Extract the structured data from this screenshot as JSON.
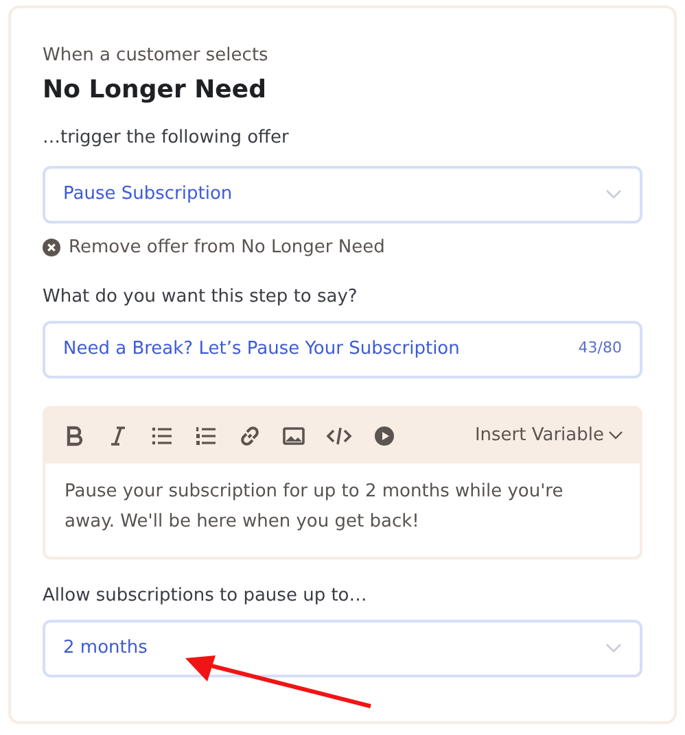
{
  "trigger": {
    "caption": "When a customer selects",
    "reason": "No Longer Need"
  },
  "offer": {
    "label": "…trigger the following offer",
    "value": "Pause Subscription",
    "remove_link": "Remove offer from No Longer Need"
  },
  "step": {
    "label": "What do you want this step to say?",
    "value": "Need a Break? Let’s Pause Your Subscription",
    "counter": "43/80"
  },
  "editor": {
    "insert_variable": "Insert Variable",
    "body": "Pause your subscription for up to 2 months while you're away. We'll be here when you get back!"
  },
  "pause": {
    "label": "Allow subscriptions to pause up to…",
    "value": "2 months"
  }
}
